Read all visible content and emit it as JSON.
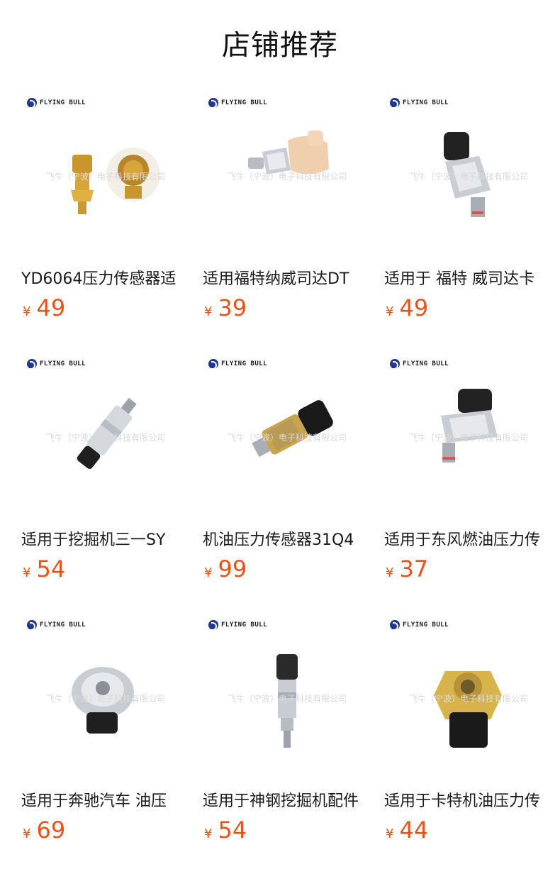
{
  "page": {
    "title": "店铺推荐"
  },
  "brand": {
    "name": "FLYING BULL",
    "watermark": "飞牛（宁波）电子科技有限公司"
  },
  "currency_symbol": "¥",
  "products": [
    {
      "name": "YD6064压力传感器适",
      "price": "49",
      "image": "brass-pressure-sensor"
    },
    {
      "name": "适用福特纳威司达DT",
      "price": "39",
      "image": "oil-pressure-switch-tan-connector"
    },
    {
      "name": "适用于 福特 威司达卡",
      "price": "49",
      "image": "silver-pressure-sensor-black-connector"
    },
    {
      "name": "适用于挖掘机三一SY",
      "price": "54",
      "image": "cylindrical-pressure-transmitter"
    },
    {
      "name": "机油压力传感器31Q4",
      "price": "99",
      "image": "brass-cylinder-pressure-sensor"
    },
    {
      "name": "适用于东风燃油压力传",
      "price": "37",
      "image": "silver-pressure-sensor-black-connector"
    },
    {
      "name": "适用于奔驰汽车 油压",
      "price": "69",
      "image": "silver-disc-pressure-switch"
    },
    {
      "name": "适用于神钢挖掘机配件",
      "price": "54",
      "image": "slim-pressure-sensor"
    },
    {
      "name": "适用于卡特机油压力传",
      "price": "44",
      "image": "brass-hex-pressure-sensor"
    }
  ]
}
